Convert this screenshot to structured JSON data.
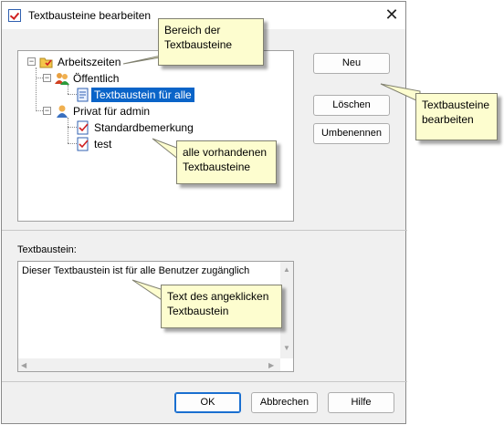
{
  "window": {
    "title": "Textbausteine bearbeiten",
    "close_symbol": "✕"
  },
  "tree": {
    "root": "Arbeitszeiten",
    "public": "Öffentlich",
    "public_item": "Textbaustein für alle",
    "private": "Privat für admin",
    "private_items": [
      "Standardbemerkung",
      "test"
    ],
    "expander_symbol": "−"
  },
  "buttons": {
    "new": "Neu",
    "delete": "Löschen",
    "rename": "Umbenennen",
    "ok": "OK",
    "cancel": "Abbrechen",
    "help": "Hilfe"
  },
  "text_section": {
    "label": "Textbaustein:",
    "content": "Dieser Textbaustein ist für alle Benutzer zugänglich"
  },
  "callouts": {
    "area": [
      "Bereich der",
      "Textbausteine"
    ],
    "edit": [
      "Textbausteine",
      "bearbeiten"
    ],
    "existing": [
      "alle vorhandenen",
      "Textbausteine"
    ],
    "selected_text": [
      "Text des angeklicken",
      "Textbaustein"
    ]
  },
  "scroll_arrows": {
    "up": "▲",
    "down": "▼",
    "left": "◀",
    "right": "▶"
  },
  "colors": {
    "selection": "#0a64c8",
    "callout_bg": "#fdfdcf",
    "accent": "#1a6fd0"
  }
}
